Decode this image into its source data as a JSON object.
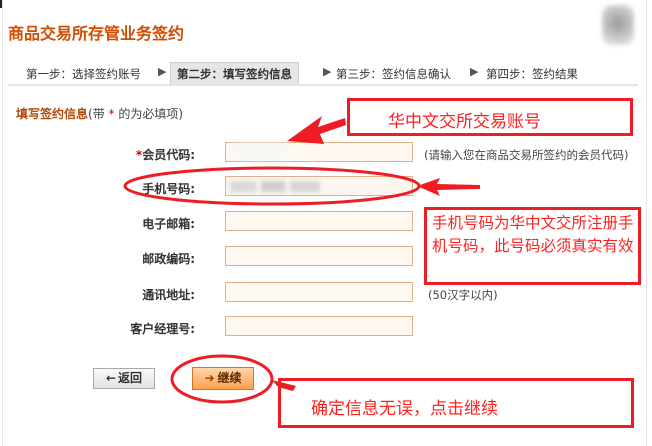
{
  "header": {
    "title": "商品交易所存管业务签约"
  },
  "steps": [
    {
      "label": "第一步：选择签约账号",
      "active": false
    },
    {
      "label": "第二步：填写签约信息",
      "active": true
    },
    {
      "label": "第三步：签约信息确认",
      "active": false
    },
    {
      "label": "第四步：签约结果",
      "active": false
    }
  ],
  "step_separator": "▶",
  "section": {
    "title": "填写签约信息",
    "note_pre": "(带 ",
    "note_star": "*",
    "note_post": " 的为必填项)"
  },
  "form": {
    "member_code": {
      "label": "会员代码:",
      "required_mark": "*",
      "hint": "(请输入您在商品交易所签约的会员代码)"
    },
    "phone": {
      "label": "手机号码:"
    },
    "email": {
      "label": "电子邮箱:"
    },
    "postcode": {
      "label": "邮政编码:"
    },
    "address": {
      "label": "通讯地址:",
      "hint": "(50汉字以内)"
    },
    "manager": {
      "label": "客户经理号:"
    }
  },
  "buttons": {
    "back": "返回",
    "back_icon": "←",
    "next": "继续",
    "next_icon": "➔"
  },
  "annotations": {
    "account_note": "华中文交所交易账号",
    "phone_note": "手机号码为华中文交所注册手机号码，此号码必须真实有效",
    "confirm_note": "确定信息无误，点击继续"
  },
  "colors": {
    "title": "#d24d00",
    "annotation": "#ee1d24",
    "field_border": "#e0b08a",
    "button_next": "#ff9f4d"
  }
}
